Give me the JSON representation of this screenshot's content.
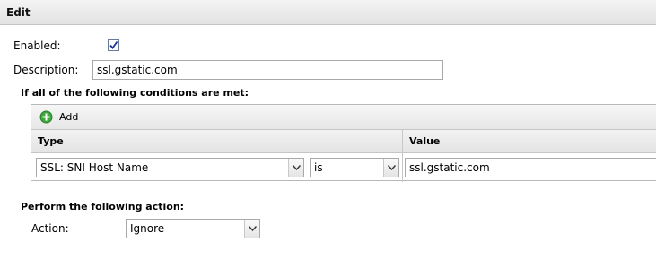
{
  "window": {
    "title": "Edit"
  },
  "form": {
    "enabled_label": "Enabled:",
    "enabled_checked": true,
    "description_label": "Description:",
    "description_value": "ssl.gstatic.com"
  },
  "conditions": {
    "heading": "If all of the following conditions are met:",
    "add_label": "Add",
    "columns": {
      "type": "Type",
      "value": "Value"
    },
    "rows": [
      {
        "type": "SSL: SNI Host Name",
        "operator": "is",
        "value": "ssl.gstatic.com"
      }
    ]
  },
  "action": {
    "heading": "Perform the following action:",
    "label": "Action:",
    "value": "Ignore"
  },
  "colors": {
    "add_icon": "#3ea83e",
    "checkmark": "#1c3a8c"
  }
}
